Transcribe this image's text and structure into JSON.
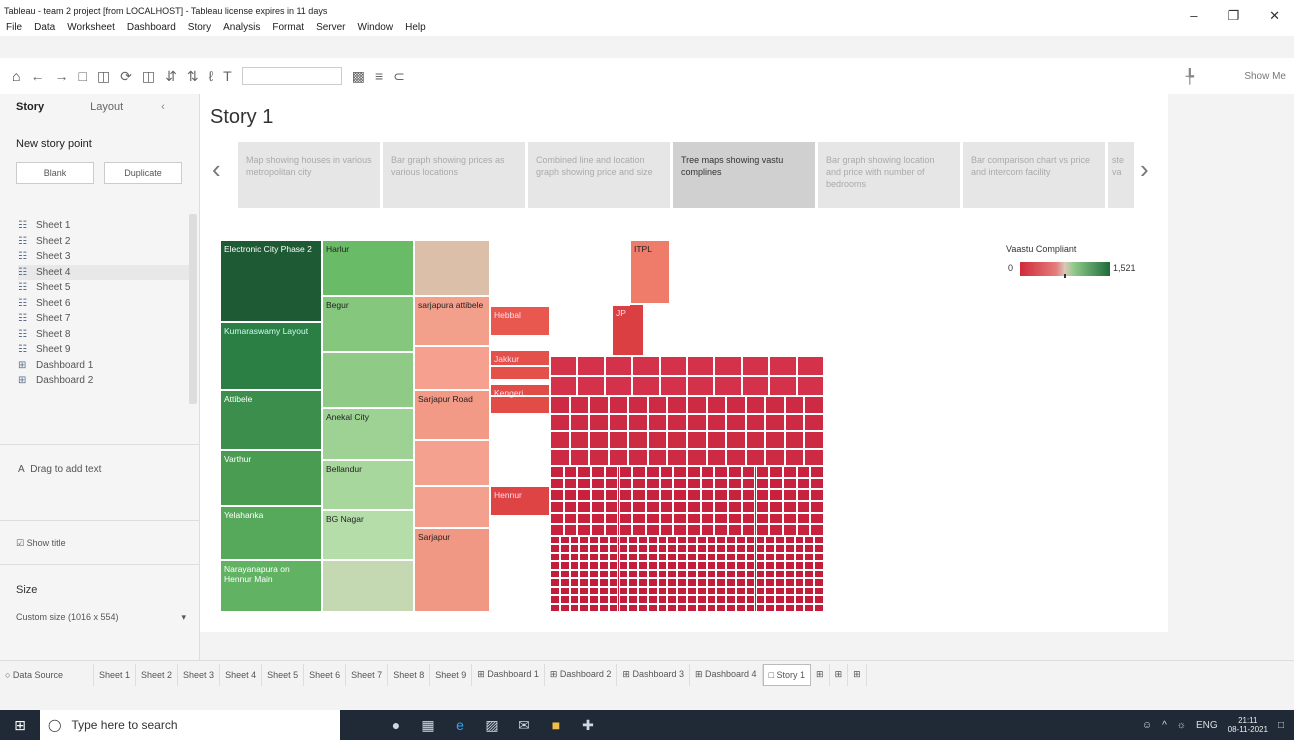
{
  "window": {
    "title": "Tableau - team 2 project [from LOCALHOST] - Tableau license expires in 11 days",
    "menu": [
      "File",
      "Data",
      "Worksheet",
      "Dashboard",
      "Story",
      "Analysis",
      "Format",
      "Server",
      "Window",
      "Help"
    ],
    "controls": [
      "–",
      "❐",
      "✕"
    ]
  },
  "toolbar": {
    "show_me": "Show Me"
  },
  "sidebar": {
    "tab_story": "Story",
    "tab_layout": "Layout",
    "collapse": "‹",
    "new_story_point": "New story point",
    "blank_button": "Blank",
    "duplicate_button": "Duplicate",
    "sheets": [
      {
        "label": "Sheet 1",
        "icon": "☷"
      },
      {
        "label": "Sheet 2",
        "icon": "☷"
      },
      {
        "label": "Sheet 3",
        "icon": "☷"
      },
      {
        "label": "Sheet 4",
        "icon": "☷"
      },
      {
        "label": "Sheet 5",
        "icon": "☷"
      },
      {
        "label": "Sheet 6",
        "icon": "☷"
      },
      {
        "label": "Sheet 7",
        "icon": "☷"
      },
      {
        "label": "Sheet 8",
        "icon": "☷"
      },
      {
        "label": "Sheet 9",
        "icon": "☷"
      },
      {
        "label": "Dashboard 1",
        "icon": "⊞"
      },
      {
        "label": "Dashboard 2",
        "icon": "⊞"
      }
    ],
    "drag_text": "Drag to add text",
    "show_title": "Show title",
    "size_label": "Size",
    "size_value": "Custom size (1016 x 554)",
    "size_caret": "▾"
  },
  "story": {
    "title": "Story 1",
    "prev": "‹",
    "next": "›",
    "points": [
      "Map showing houses in various metropolitan city",
      "Bar graph showing prices as various locations",
      "Combined line and location graph showing price and size",
      "Tree maps showing vastu complines",
      "Bar graph showing location and price with number of bedrooms",
      "Bar comparison chart vs price and intercom facility",
      "ste va"
    ],
    "active_index": 3
  },
  "treemap": {
    "cells": [
      {
        "label": "Electronic City Phase 2",
        "c": "#1e5b34"
      },
      {
        "label": "Kumaraswamy Layout",
        "c": "#2b7e44"
      },
      {
        "label": "Attibele",
        "c": "#3b8e4c"
      },
      {
        "label": "Varthur",
        "c": "#4a9c52"
      },
      {
        "label": "Yelahanka",
        "c": "#56a85a"
      },
      {
        "label": "Narayanapura on Hennur Main",
        "c": "#62b263"
      },
      {
        "label": "Harlur",
        "c": "#6abb68"
      },
      {
        "label": "Begur",
        "c": "#86c77e"
      },
      {
        "label": "",
        "c": "#8fcb86"
      },
      {
        "label": "Anekal City",
        "c": "#9ed294"
      },
      {
        "label": "Bellandur",
        "c": "#a8d79d"
      },
      {
        "label": "BG Nagar",
        "c": "#b4dda9"
      },
      {
        "label": "",
        "c": "#c4d8b1"
      },
      {
        "label": "",
        "c": "#dbbfa9"
      },
      {
        "label": "sarjapura attibele",
        "c": "#f2a08c"
      },
      {
        "label": "",
        "c": "#f6a190"
      },
      {
        "label": "Sarjapur Road",
        "c": "#f39a87"
      },
      {
        "label": "",
        "c": "#f5a18f"
      },
      {
        "label": "",
        "c": "#f4a08e"
      },
      {
        "label": "Sarjapur",
        "c": "#f19884"
      },
      {
        "label": "ITPL",
        "c": "#ef7b6b"
      },
      {
        "label": "Hebbal",
        "c": "#e8584f"
      },
      {
        "label": "Jakkur",
        "c": "#e4514a"
      },
      {
        "label": "Kengeri",
        "c": "#e24c47"
      },
      {
        "label": "Hennur",
        "c": "#df4444"
      },
      {
        "label": "JP",
        "c": "#dc3f42"
      },
      {
        "label": "",
        "c": "#d3324a"
      },
      {
        "label": "",
        "c": "#cd2a44"
      },
      {
        "label": "",
        "c": "#c9223f"
      },
      {
        "label": "",
        "c": "#c31d3c"
      }
    ]
  },
  "legend": {
    "title": "Vaastu Compliant",
    "min": "0",
    "max": "1,521",
    "low_color": "#cf2a3a",
    "high_color": "#1e6b3b"
  },
  "tabs": [
    {
      "label": "○ Data Source"
    },
    {
      "label": "Sheet 1"
    },
    {
      "label": "Sheet 2"
    },
    {
      "label": "Sheet 3"
    },
    {
      "label": "Sheet 4"
    },
    {
      "label": "Sheet 5"
    },
    {
      "label": "Sheet 6"
    },
    {
      "label": "Sheet 7"
    },
    {
      "label": "Sheet 8"
    },
    {
      "label": "Sheet 9"
    },
    {
      "label": "⊞ Dashboard 1"
    },
    {
      "label": "⊞ Dashboard 2"
    },
    {
      "label": "⊞ Dashboard 3"
    },
    {
      "label": "⊞ Dashboard 4"
    },
    {
      "label": "□ Story 1"
    }
  ],
  "taskbar": {
    "search_placeholder": "Type here to search",
    "lang": "ENG",
    "time": "21:11",
    "date": "08-11-2021"
  }
}
